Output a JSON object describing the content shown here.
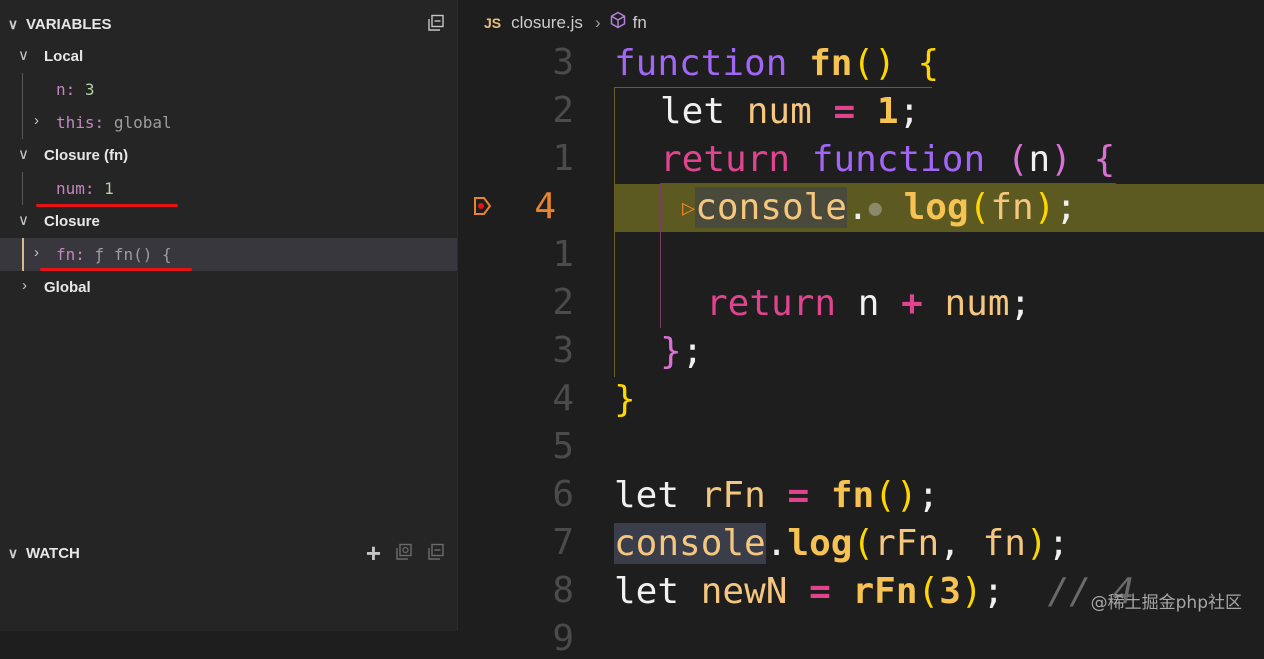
{
  "variables": {
    "title": "VARIABLES",
    "local_label": "Local",
    "local_n_name": "n:",
    "local_n_value": "3",
    "local_this_name": "this:",
    "local_this_value": "global",
    "closure_fn_label": "Closure (fn)",
    "closure_num_name": "num:",
    "closure_num_value": "1",
    "closure_label": "Closure",
    "closure_fn_name": "fn:",
    "closure_fn_value": "ƒ fn() {",
    "global_label": "Global",
    "collapse_icon": "collapse-all-icon"
  },
  "watch": {
    "title": "WATCH",
    "add_icon": "plus-icon",
    "refresh_icon": "refresh-icon",
    "collapse_icon": "collapse-all-icon"
  },
  "editor": {
    "tab_lang": "JS",
    "file_name": "closure.js",
    "breadcrumb_symbol": "fn",
    "line_numbers": [
      "3",
      "2",
      "1",
      "4",
      "1",
      "2",
      "3",
      "4",
      "5",
      "6",
      "7",
      "8",
      "9"
    ],
    "current_line": "4",
    "code": {
      "l1_kw": "function",
      "l1_fn": "fn",
      "l1_paren": "()",
      "l1_brace": "{",
      "l2_kw": "let",
      "l2_id": "num",
      "l2_op": "=",
      "l2_num": "1",
      "l2_semi": ";",
      "l3_kw": "return",
      "l3_kw2": "function",
      "l3_lp": "(",
      "l3_param": "n",
      "l3_rp": ")",
      "l3_brace": "{",
      "l4_obj": "console",
      "l4_dot": ".",
      "l4_method": "log",
      "l4_lp": "(",
      "l4_arg": "fn",
      "l4_rp": ")",
      "l4_semi": ";",
      "l6_kw": "return",
      "l6_a": "n",
      "l6_op": "+",
      "l6_b": "num",
      "l6_semi": ";",
      "l7_brace": "}",
      "l7_semi": ";",
      "l8_brace": "}",
      "l10_kw": "let",
      "l10_id": "rFn",
      "l10_op": "=",
      "l10_fn": "fn",
      "l10_paren": "()",
      "l10_semi": ";",
      "l11_obj": "console",
      "l11_dot": ".",
      "l11_method": "log",
      "l11_lp": "(",
      "l11_a": "rFn",
      "l11_comma": ",",
      "l11_b": "fn",
      "l11_rp": ")",
      "l11_semi": ";",
      "l12_kw": "let",
      "l12_id": "newN",
      "l12_op": "=",
      "l12_fn": "rFn",
      "l12_lp": "(",
      "l12_num": "3",
      "l12_rp": ")",
      "l12_semi": ";",
      "l12_comment": "// 4"
    }
  },
  "watermark": "@稀土掘金php社区"
}
